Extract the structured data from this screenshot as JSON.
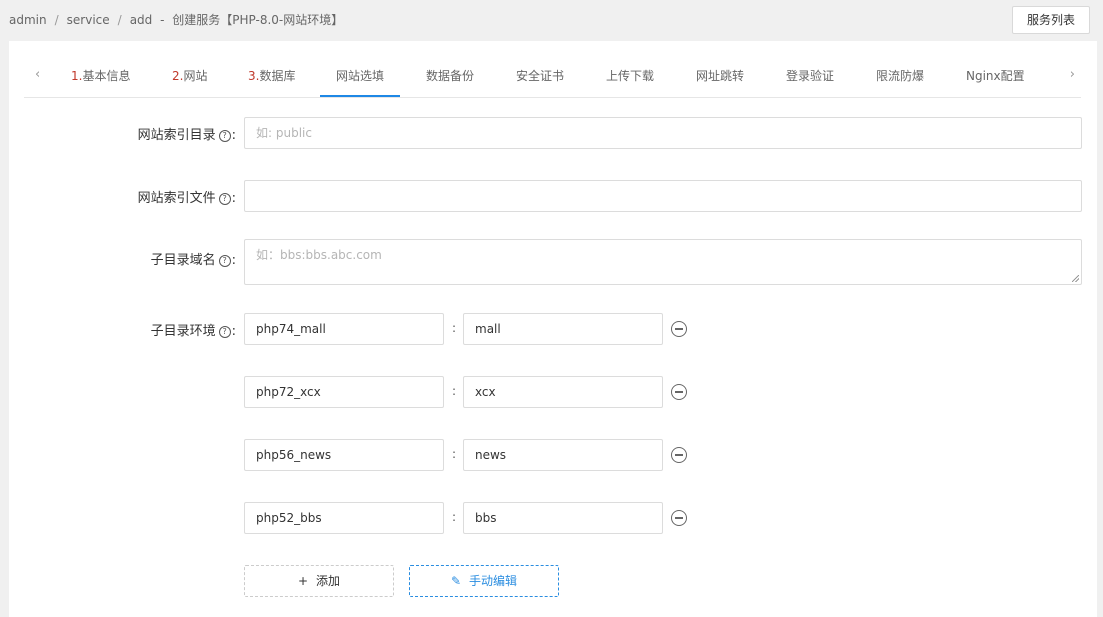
{
  "breadcrumb": {
    "items": [
      "admin",
      "service",
      "add"
    ],
    "separator": "/",
    "title_dash": "-",
    "title": "创建服务【PHP-8.0-网站环境】"
  },
  "header": {
    "service_list_button": "服务列表"
  },
  "tabs": [
    {
      "num": "1.",
      "label": "基本信息"
    },
    {
      "num": "2.",
      "label": "网站"
    },
    {
      "num": "3.",
      "label": "数据库"
    },
    {
      "num": "",
      "label": "网站选填"
    },
    {
      "num": "",
      "label": "数据备份"
    },
    {
      "num": "",
      "label": "安全证书"
    },
    {
      "num": "",
      "label": "上传下载"
    },
    {
      "num": "",
      "label": "网址跳转"
    },
    {
      "num": "",
      "label": "登录验证"
    },
    {
      "num": "",
      "label": "限流防爆"
    },
    {
      "num": "",
      "label": "Nginx配置"
    }
  ],
  "tab_nav": {
    "prev": "‹",
    "next": "›"
  },
  "form": {
    "help_glyph": "?",
    "colon": ":",
    "index_dir": {
      "label": "网站索引目录",
      "placeholder": "如: public",
      "value": ""
    },
    "index_file": {
      "label": "网站索引文件",
      "placeholder": "",
      "value": ""
    },
    "subdir_domain": {
      "label": "子目录域名",
      "placeholder": "如：bbs:bbs.abc.com",
      "value": ""
    },
    "subdir_env": {
      "label": "子目录环境",
      "rows": [
        {
          "env": "php74_mall",
          "dir": "mall"
        },
        {
          "env": "php72_xcx",
          "dir": "xcx"
        },
        {
          "env": "php56_news",
          "dir": "news"
        },
        {
          "env": "php52_bbs",
          "dir": "bbs"
        }
      ]
    },
    "add_button": {
      "icon": "+",
      "label": "添加"
    },
    "manual_edit_button": {
      "icon": "✎",
      "label": "手动编辑"
    }
  },
  "colors": {
    "accent": "#1e88e5",
    "step_number": "#c0392b",
    "link_blue": "#2a8de0"
  }
}
